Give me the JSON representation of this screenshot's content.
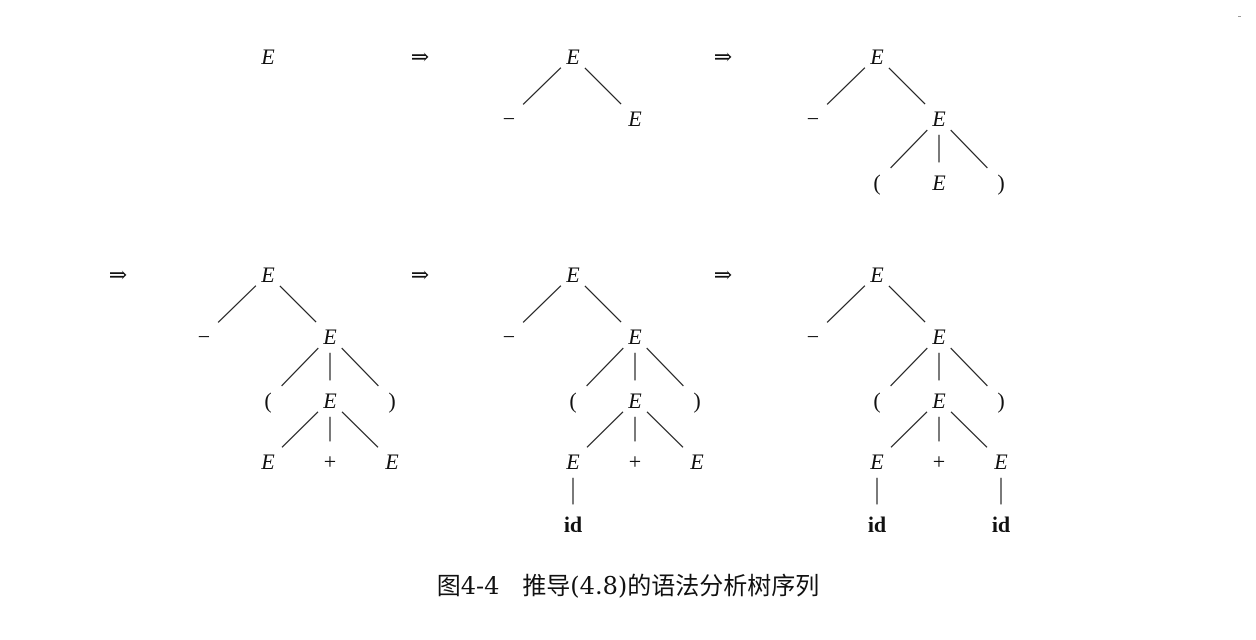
{
  "figure": {
    "arrow_symbol": "⇒",
    "derivation_steps": [
      {
        "nodes": [
          [
            "E",
            "var"
          ]
        ],
        "edges": []
      },
      {
        "nodes": [
          [
            "E",
            "var"
          ],
          [
            "−",
            "sym"
          ],
          [
            "E",
            "var"
          ]
        ],
        "edges": [
          [
            0,
            1
          ],
          [
            0,
            2
          ]
        ]
      },
      {
        "nodes": [
          [
            "E",
            "var"
          ],
          [
            "−",
            "sym"
          ],
          [
            "E",
            "var"
          ],
          [
            "(",
            "sym"
          ],
          [
            "E",
            "var"
          ],
          [
            ")",
            "sym"
          ]
        ],
        "edges": [
          [
            0,
            1
          ],
          [
            0,
            2
          ],
          [
            2,
            3
          ],
          [
            2,
            4
          ],
          [
            2,
            5
          ]
        ]
      },
      {
        "nodes": [
          [
            "E",
            "var"
          ],
          [
            "−",
            "sym"
          ],
          [
            "E",
            "var"
          ],
          [
            "(",
            "sym"
          ],
          [
            "E",
            "var"
          ],
          [
            ")",
            "sym"
          ],
          [
            "E",
            "var"
          ],
          [
            "+",
            "sym"
          ],
          [
            "E",
            "var"
          ]
        ],
        "edges": [
          [
            0,
            1
          ],
          [
            0,
            2
          ],
          [
            2,
            3
          ],
          [
            2,
            4
          ],
          [
            2,
            5
          ],
          [
            4,
            6
          ],
          [
            4,
            7
          ],
          [
            4,
            8
          ]
        ]
      },
      {
        "nodes": [
          [
            "E",
            "var"
          ],
          [
            "−",
            "sym"
          ],
          [
            "E",
            "var"
          ],
          [
            "(",
            "sym"
          ],
          [
            "E",
            "var"
          ],
          [
            ")",
            "sym"
          ],
          [
            "E",
            "var"
          ],
          [
            "+",
            "sym"
          ],
          [
            "E",
            "var"
          ],
          [
            "id",
            "bold"
          ]
        ],
        "edges": [
          [
            0,
            1
          ],
          [
            0,
            2
          ],
          [
            2,
            3
          ],
          [
            2,
            4
          ],
          [
            2,
            5
          ],
          [
            4,
            6
          ],
          [
            4,
            7
          ],
          [
            4,
            8
          ],
          [
            6,
            9
          ]
        ]
      },
      {
        "nodes": [
          [
            "E",
            "var"
          ],
          [
            "−",
            "sym"
          ],
          [
            "E",
            "var"
          ],
          [
            "(",
            "sym"
          ],
          [
            "E",
            "var"
          ],
          [
            ")",
            "sym"
          ],
          [
            "E",
            "var"
          ],
          [
            "+",
            "sym"
          ],
          [
            "E",
            "var"
          ],
          [
            "id",
            "bold"
          ],
          [
            "id",
            "bold"
          ]
        ],
        "edges": [
          [
            0,
            1
          ],
          [
            0,
            2
          ],
          [
            2,
            3
          ],
          [
            2,
            4
          ],
          [
            2,
            5
          ],
          [
            4,
            6
          ],
          [
            4,
            7
          ],
          [
            4,
            8
          ],
          [
            6,
            9
          ],
          [
            8,
            10
          ]
        ]
      }
    ]
  },
  "caption": {
    "number": "图4-4",
    "text": "推导(4.8)的语法分析树序列"
  }
}
